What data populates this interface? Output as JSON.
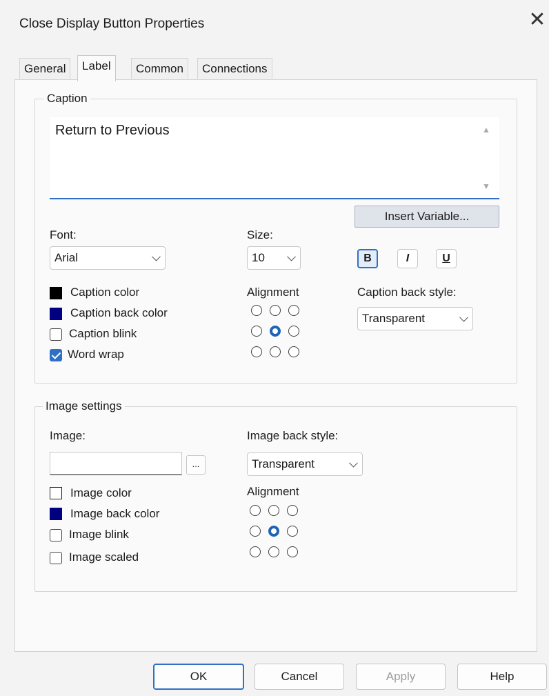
{
  "dialog": {
    "title": "Close Display Button Properties",
    "close_glyph": "✕"
  },
  "tabs": [
    {
      "label": "General",
      "active": false
    },
    {
      "label": "Label",
      "active": true
    },
    {
      "label": "Common",
      "active": false
    },
    {
      "label": "Connections",
      "active": false
    }
  ],
  "caption_group": {
    "label": "Caption",
    "text_value": "Return to Previous",
    "insert_variable_label": "Insert Variable...",
    "font_label": "Font:",
    "font_value": "Arial",
    "size_label": "Size:",
    "size_value": "10",
    "bold_label": "B",
    "italic_label": "I",
    "underline_label": "U",
    "bold_pressed": true,
    "caption_color_label": "Caption color",
    "caption_color": "#000000",
    "caption_back_color_label": "Caption back color",
    "caption_back_color": "#000080",
    "caption_blink_label": "Caption blink",
    "caption_blink_checked": false,
    "word_wrap_label": "Word wrap",
    "word_wrap_checked": true,
    "alignment_label": "Alignment",
    "alignment_selected": "middle-center",
    "back_style_label": "Caption back style:",
    "back_style_value": "Transparent"
  },
  "image_group": {
    "label": "Image settings",
    "image_label": "Image:",
    "image_value": "",
    "browse_label": "...",
    "image_color_label": "Image color",
    "image_color": "#ffffff",
    "image_back_color_label": "Image back color",
    "image_back_color": "#000080",
    "image_blink_label": "Image blink",
    "image_blink_checked": false,
    "image_scaled_label": "Image scaled",
    "image_scaled_checked": false,
    "back_style_label": "Image back style:",
    "back_style_value": "Transparent",
    "alignment_label": "Alignment",
    "alignment_selected": "middle-center"
  },
  "footer": {
    "ok_label": "OK",
    "cancel_label": "Cancel",
    "apply_label": "Apply",
    "help_label": "Help"
  },
  "colors": {
    "accent": "#2f6fc4",
    "navy_swatch": "#000080"
  }
}
